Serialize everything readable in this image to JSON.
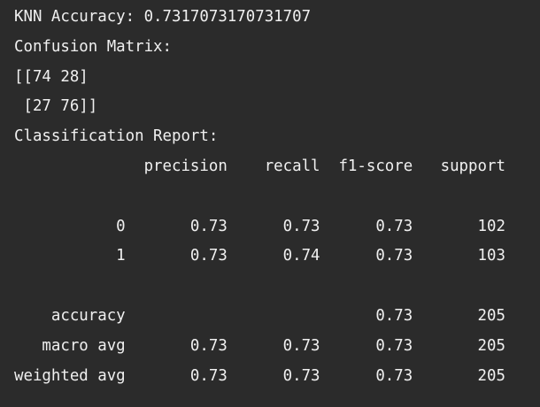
{
  "output": {
    "lines": [
      "KNN Accuracy: 0.7317073170731707",
      "Confusion Matrix:",
      "[[74 28]",
      " [27 76]]",
      "Classification Report:",
      "              precision    recall  f1-score   support",
      "",
      "           0       0.73      0.73      0.73       102",
      "           1       0.73      0.74      0.73       103",
      "",
      "    accuracy                           0.73       205",
      "   macro avg       0.73      0.73      0.73       205",
      "weighted avg       0.73      0.73      0.73       205"
    ]
  }
}
